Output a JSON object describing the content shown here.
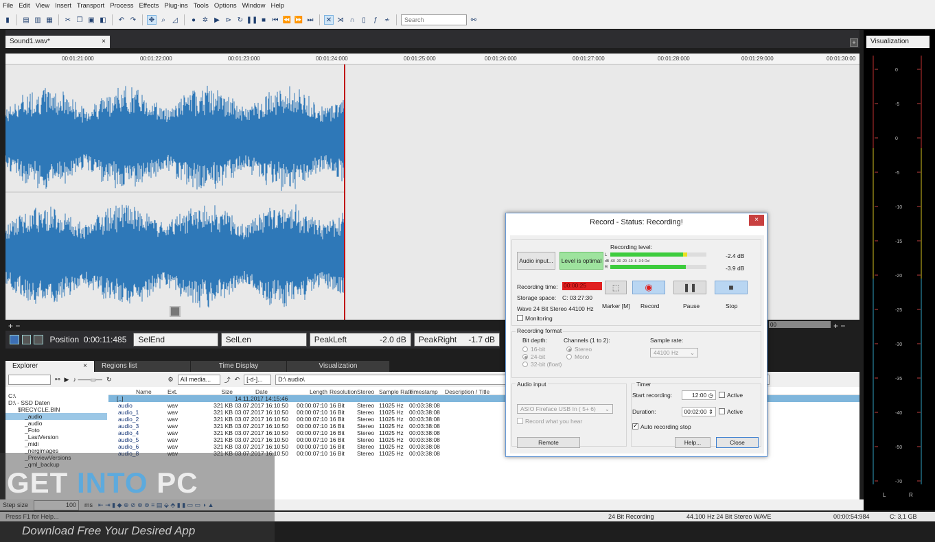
{
  "menu": [
    "File",
    "Edit",
    "View",
    "Insert",
    "Transport",
    "Process",
    "Effects",
    "Plug-ins",
    "Tools",
    "Options",
    "Window",
    "Help"
  ],
  "toolbar": {
    "search_placeholder": "Search"
  },
  "document": {
    "tab_title": "Sound1.wav*",
    "close": "×"
  },
  "visualization": {
    "tab_title": "Visualization",
    "scale": [
      "0",
      "-5",
      "0",
      "-5",
      "-10",
      "-15",
      "-20",
      "-25",
      "-30",
      "-35",
      "-40",
      "-50",
      "-70"
    ],
    "channels": [
      "L",
      "R"
    ]
  },
  "ruler": [
    "00:01:21:000",
    "00:01:22:000",
    "00:01:23:000",
    "00:01:24:000",
    "00:01:25:000",
    "00:01:26:000",
    "00:01:27:000",
    "00:01:28:000",
    "00:01:29:000",
    "00:01:30:00"
  ],
  "status": {
    "position_label": "Position",
    "position_value": "0:00:11:485",
    "selend_label": "SelEnd",
    "sellen_label": "SelLen",
    "peakleft_label": "PeakLeft",
    "peakleft_value": "-2.0 dB",
    "peakright_label": "PeakRight",
    "peakright_value": "-1.7 dB",
    "zoom_plus": "+",
    "zoom_minus": "−",
    "timeline_end": "00"
  },
  "panels": {
    "tabs": [
      "Explorer",
      "Regions list",
      "Time Display",
      "Visualization"
    ],
    "close": "×"
  },
  "explorer": {
    "filter": "All media...",
    "format": "[-d-]...",
    "path": "D:\\  audio\\",
    "tree": [
      "C:\\",
      "D:\\ - SSD Daten",
      "$RECYCLE.BIN",
      "_audio",
      "_audio",
      "_Foto",
      "_LastVersion",
      "_midi",
      "_nergimages",
      "_PreviewVersions",
      "_qml_backup"
    ],
    "columns": [
      "Name",
      "Ext.",
      "Size",
      "Date",
      "Length",
      "Resolution",
      "Stereo",
      "Sample Rate",
      "Timestamp",
      "Description / Title"
    ],
    "updir": {
      "name": "[..]",
      "date": "14.11.2017 14:15:46"
    },
    "files": [
      [
        "audio",
        "wav",
        "321 KB",
        "03.07.2017 16:10:50",
        "00:00:07:10",
        "16 Bit",
        "Stereo",
        "11025 Hz",
        "00:03:38:08"
      ],
      [
        "audio_1",
        "wav",
        "321 KB",
        "03.07.2017 16:10:50",
        "00:00:07:10",
        "16 Bit",
        "Stereo",
        "11025 Hz",
        "00:03:38:08"
      ],
      [
        "audio_2",
        "wav",
        "321 KB",
        "03.07.2017 16:10:50",
        "00:00:07:10",
        "16 Bit",
        "Stereo",
        "11025 Hz",
        "00:03:38:08"
      ],
      [
        "audio_3",
        "wav",
        "321 KB",
        "03.07.2017 16:10:50",
        "00:00:07:10",
        "16 Bit",
        "Stereo",
        "11025 Hz",
        "00:03:38:08"
      ],
      [
        "audio_4",
        "wav",
        "321 KB",
        "03.07.2017 16:10:50",
        "00:00:07:10",
        "16 Bit",
        "Stereo",
        "11025 Hz",
        "00:03:38:08"
      ],
      [
        "audio_5",
        "wav",
        "321 KB",
        "03.07.2017 16:10:50",
        "00:00:07:10",
        "16 Bit",
        "Stereo",
        "11025 Hz",
        "00:03:38:08"
      ],
      [
        "audio_6",
        "wav",
        "321 KB",
        "03.07.2017 16:10:50",
        "00:00:07:10",
        "16 Bit",
        "Stereo",
        "11025 Hz",
        "00:03:38:08"
      ],
      [
        "audio_8",
        "wav",
        "321 KB",
        "03.07.2017 16:10:50",
        "00:00:07:10",
        "16 Bit",
        "Stereo",
        "11025 Hz",
        "00:03:38:08"
      ]
    ]
  },
  "stepbar": {
    "label": "Step size",
    "value": "100",
    "unit": "ms"
  },
  "statusbar": {
    "help": "Press F1 for Help...",
    "mode": "24 Bit Recording",
    "format": "44.100 Hz  24 Bit  Stereo  WAVE",
    "time": "00:00:54:984",
    "disk": "C: 3,1 GB"
  },
  "dialog": {
    "title": "Record - Status: Recording!",
    "close": "×",
    "audio_input_btn": "Audio input...",
    "level_status": "Level is optimal",
    "recording_level_label": "Recording level:",
    "level_L": "-2.4  dB",
    "level_R": "-3.9  dB",
    "meter_scale": "dB  -60  -30  -20  -10  -6  -3  0  Ovl",
    "recording_time_label": "Recording time:",
    "recording_time": "00:00:25",
    "storage_label": "Storage space:",
    "storage_value": "C: 03:27:30",
    "wave_info": "Wave  24 Bit  Stereo  44100 Hz",
    "monitoring": "Monitoring",
    "transport": {
      "marker": "Marker [M]",
      "record": "Record",
      "pause": "Pause",
      "stop": "Stop"
    },
    "format_group": "Recording format",
    "bit_depth_label": "Bit depth:",
    "bit_depths": [
      "16-bit",
      "24-bit",
      "32-bit (float)"
    ],
    "channels_label": "Channels (1 to 2):",
    "channels": [
      "Stereo",
      "Mono"
    ],
    "sample_rate_label": "Sample rate:",
    "sample_rate": "44100 Hz",
    "audio_input_group": "Audio input",
    "device": "ASIO Fireface USB In ( 5+ 6)",
    "record_what_you_hear": "Record what you hear",
    "timer_group": "Timer",
    "start_label": "Start recording:",
    "start_value": "12:00",
    "duration_label": "Duration:",
    "duration_value": "00:02:00",
    "active": "Active",
    "auto_stop": "Auto recording stop",
    "remote": "Remote",
    "help": "Help...",
    "close_btn": "Close"
  },
  "watermark": {
    "part1": "GET",
    "part2": "INTO",
    "part3": "PC",
    "tagline": "Download Free Your Desired App"
  },
  "colors": {
    "waveform": "#2e78b8",
    "cursor": "#c00000",
    "dark": "#1e1e1e",
    "meter_green": "#3dcc3d",
    "rec_red": "#e02020"
  }
}
